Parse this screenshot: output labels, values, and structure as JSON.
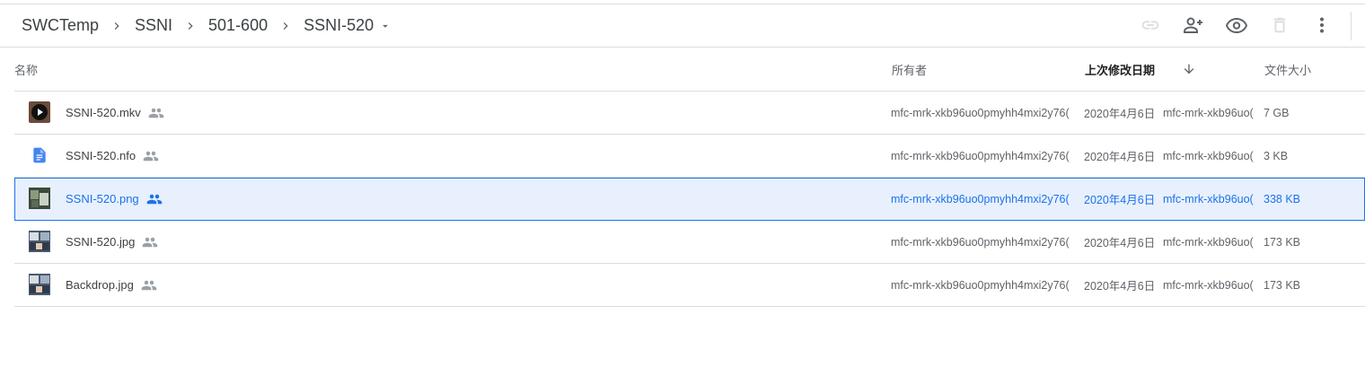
{
  "breadcrumb": {
    "items": [
      "SWCTemp",
      "SSNI",
      "501-600"
    ],
    "current": "SSNI-520"
  },
  "toolbar": {
    "icons": [
      "link-icon",
      "share-icon",
      "preview-icon",
      "delete-icon",
      "more-icon"
    ]
  },
  "columns": {
    "name": "名称",
    "owner": "所有者",
    "modified": "上次修改日期",
    "size": "文件大小"
  },
  "files": [
    {
      "name": "SSNI-520.mkv",
      "type": "video",
      "owner": "mfc-mrk-xkb96uo0pmyhh4mxi2y76(",
      "date": "2020年4月6日",
      "modified_by": "mfc-mrk-xkb96uo(",
      "size": "7 GB",
      "selected": false
    },
    {
      "name": "SSNI-520.nfo",
      "type": "doc",
      "owner": "mfc-mrk-xkb96uo0pmyhh4mxi2y76(",
      "date": "2020年4月6日",
      "modified_by": "mfc-mrk-xkb96uo(",
      "size": "3 KB",
      "selected": false
    },
    {
      "name": "SSNI-520.png",
      "type": "image",
      "owner": "mfc-mrk-xkb96uo0pmyhh4mxi2y76(",
      "date": "2020年4月6日",
      "modified_by": "mfc-mrk-xkb96uo(",
      "size": "338 KB",
      "selected": true
    },
    {
      "name": "SSNI-520.jpg",
      "type": "image",
      "owner": "mfc-mrk-xkb96uo0pmyhh4mxi2y76(",
      "date": "2020年4月6日",
      "modified_by": "mfc-mrk-xkb96uo(",
      "size": "173 KB",
      "selected": false
    },
    {
      "name": "Backdrop.jpg",
      "type": "image",
      "owner": "mfc-mrk-xkb96uo0pmyhh4mxi2y76(",
      "date": "2020年4月6日",
      "modified_by": "mfc-mrk-xkb96uo(",
      "size": "173 KB",
      "selected": false
    }
  ],
  "colors": {
    "accent": "#1a73e8",
    "selected_bg": "#e8f0fe",
    "divider": "#dadce0",
    "icon": "#5f6368"
  }
}
